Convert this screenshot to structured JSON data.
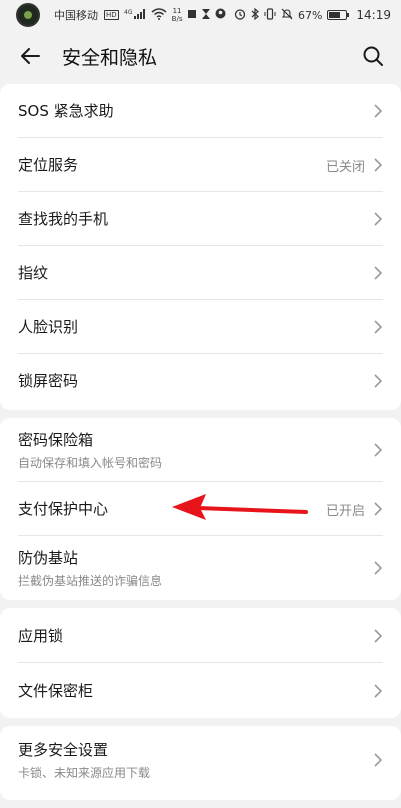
{
  "status_bar": {
    "carrier": "中国移动",
    "hd": "HD",
    "network": "4G",
    "speed_value": "11",
    "speed_unit": "B/s",
    "battery": "67%",
    "time": "14:19"
  },
  "header": {
    "title": "安全和隐私"
  },
  "group1": [
    {
      "title": "SOS 紧急求助",
      "status": ""
    },
    {
      "title": "定位服务",
      "status": "已关闭"
    },
    {
      "title": "查找我的手机",
      "status": ""
    },
    {
      "title": "指纹",
      "status": ""
    },
    {
      "title": "人脸识别",
      "status": ""
    },
    {
      "title": "锁屏密码",
      "status": ""
    }
  ],
  "group2": [
    {
      "title": "密码保险箱",
      "subtitle": "自动保存和填入帐号和密码",
      "status": ""
    },
    {
      "title": "支付保护中心",
      "subtitle": "",
      "status": "已开启"
    },
    {
      "title": "防伪基站",
      "subtitle": "拦截伪基站推送的诈骗信息",
      "status": ""
    }
  ],
  "group3": [
    {
      "title": "应用锁",
      "status": ""
    },
    {
      "title": "文件保密柜",
      "status": ""
    }
  ],
  "group4": [
    {
      "title": "更多安全设置",
      "subtitle": "卡锁、未知来源应用下载",
      "status": ""
    }
  ],
  "colors": {
    "background": "#f2f2f2",
    "card": "#ffffff",
    "annotation_arrow": "#e8141b"
  }
}
